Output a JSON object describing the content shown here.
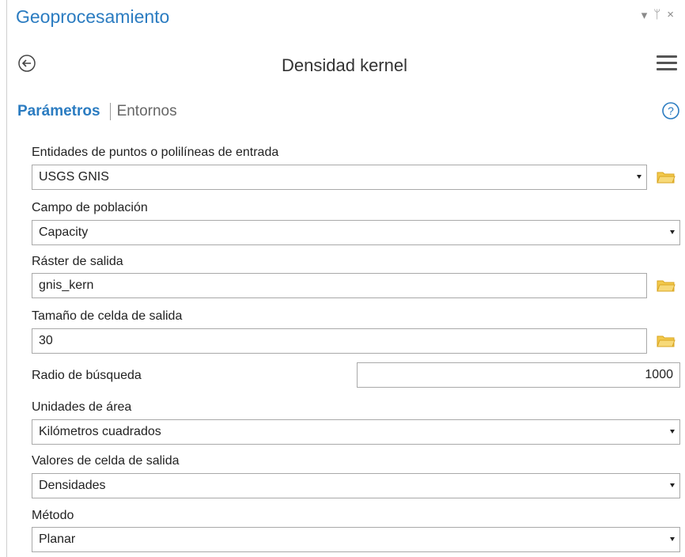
{
  "pane": {
    "title": "Geoprocesamiento",
    "controls": {
      "dropdown": "▾",
      "pin": "ᛘ",
      "close": "×"
    }
  },
  "tool": {
    "title": "Densidad kernel"
  },
  "tabs": {
    "parameters": "Parámetros",
    "environments": "Entornos"
  },
  "icons": {
    "back": "back-arrow-icon",
    "menu": "hamburger-menu-icon",
    "help": "help-icon",
    "folder": "folder-icon",
    "dropdown": "chevron-down-icon"
  },
  "colors": {
    "accent": "#2b7cc1",
    "folder": "#f2c94c",
    "border": "#a9a9a9"
  },
  "params": {
    "input_features": {
      "label": "Entidades de puntos o polilíneas de entrada",
      "value": "USGS GNIS"
    },
    "population_field": {
      "label": "Campo de población",
      "value": "Capacity"
    },
    "output_raster": {
      "label": "Ráster de salida",
      "value": "gnis_kern"
    },
    "cell_size": {
      "label": "Tamaño de celda de salida",
      "value": "30"
    },
    "search_radius": {
      "label": "Radio de búsqueda",
      "value": "1000"
    },
    "area_units": {
      "label": "Unidades de área",
      "value": "Kilómetros cuadrados"
    },
    "output_values": {
      "label": "Valores de celda de salida",
      "value": "Densidades"
    },
    "method": {
      "label": "Método",
      "value": "Planar"
    }
  }
}
